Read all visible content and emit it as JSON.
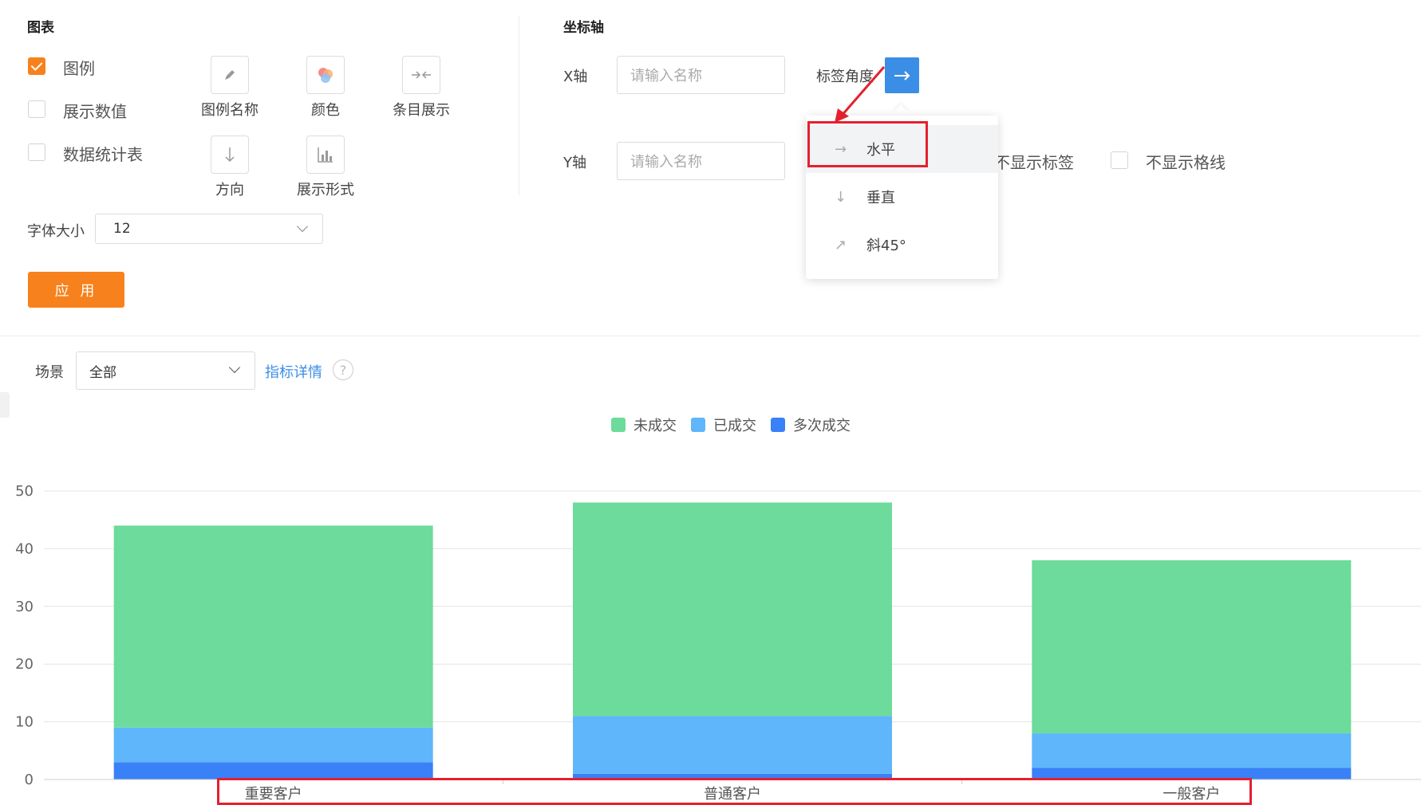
{
  "chart_panel": {
    "title": "图表",
    "checkboxes": [
      {
        "label": "图例",
        "checked": true
      },
      {
        "label": "展示数值",
        "checked": false
      },
      {
        "label": "数据统计表",
        "checked": false
      }
    ],
    "tools": [
      {
        "label": "图例名称",
        "icon": "pencil-icon"
      },
      {
        "label": "颜色",
        "icon": "color-palette-icon"
      },
      {
        "label": "条目展示",
        "icon": "compress-arrows-icon"
      },
      {
        "label": "方向",
        "icon": "arrow-down-icon"
      },
      {
        "label": "展示形式",
        "icon": "bar-chart-icon"
      }
    ],
    "font_size_label": "字体大小",
    "font_size_value": "12",
    "apply_label": "应 用"
  },
  "axis_panel": {
    "title": "坐标轴",
    "x_label": "X轴",
    "x_placeholder": "请输入名称",
    "y_label": "Y轴",
    "y_placeholder": "请输入名称",
    "angle_label": "标签角度",
    "hide_label_text": "不显示标签",
    "hide_grid_text": "不显示格线",
    "dropdown": [
      {
        "label": "水平",
        "icon": "arrow-right-icon",
        "selected": true
      },
      {
        "label": "垂直",
        "icon": "arrow-down-icon",
        "selected": false
      },
      {
        "label": "斜45°",
        "icon": "arrow-diagonal-icon",
        "selected": false
      }
    ]
  },
  "filter": {
    "scene_label": "场景",
    "scene_value": "全部",
    "detail_link": "指标详情"
  },
  "colors": {
    "accent": "#f7811c",
    "primary_blue": "#3a8ee6",
    "link": "#3a8ee6",
    "highlight_red": "#e4202f"
  },
  "chart_data": {
    "type": "bar",
    "stacked": true,
    "categories": [
      "重要客户",
      "普通客户",
      "一般客户"
    ],
    "series": [
      {
        "name": "多次成交",
        "color": "#3a80f7",
        "values": [
          3,
          1,
          2
        ]
      },
      {
        "name": "已成交",
        "color": "#5fb6fa",
        "values": [
          6,
          10,
          6
        ]
      },
      {
        "name": "未成交",
        "color": "#6ddb9b",
        "values": [
          35,
          37,
          30
        ]
      }
    ],
    "legend_order": [
      "未成交",
      "已成交",
      "多次成交"
    ],
    "yticks": [
      0,
      10,
      20,
      30,
      40,
      50
    ],
    "ylim": [
      0,
      50
    ],
    "grid": true,
    "legend_position": "top-center"
  }
}
